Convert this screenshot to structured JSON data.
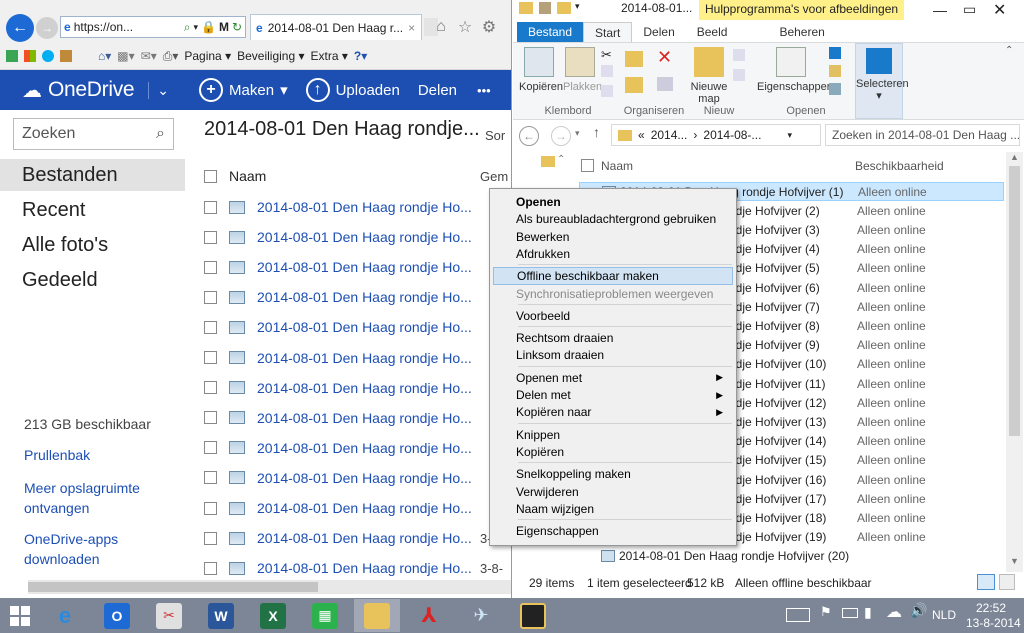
{
  "ie": {
    "url": "https://on...",
    "tab_title": "2014-08-01 Den Haag r...",
    "command_bar": {
      "page": "Pagina",
      "security": "Beveiliging",
      "extra": "Extra"
    }
  },
  "onedrive": {
    "brand": "OneDrive",
    "create": "Maken",
    "upload": "Uploaden",
    "delete": "Delen",
    "more": "•••",
    "search_placeholder": "Zoeken",
    "nav": [
      "Bestanden",
      "Recent",
      "Alle foto's",
      "Gedeeld"
    ],
    "storage": "213 GB beschikbaar",
    "recycle": "Prullenbak",
    "more_storage": "Meer opslagruimte ontvangen",
    "apps": "OneDrive-apps downloaden",
    "folder_title": "2014-08-01 Den Haag rondje...",
    "sort_label": "Sor",
    "col_name": "Naam",
    "col_date": "Gem",
    "files": [
      "2014-08-01 Den Haag rondje Ho...",
      "2014-08-01 Den Haag rondje Ho...",
      "2014-08-01 Den Haag rondje Ho...",
      "2014-08-01 Den Haag rondje Ho...",
      "2014-08-01 Den Haag rondje Ho...",
      "2014-08-01 Den Haag rondje Ho...",
      "2014-08-01 Den Haag rondje Ho...",
      "2014-08-01 Den Haag rondje Ho...",
      "2014-08-01 Den Haag rondje Ho...",
      "2014-08-01 Den Haag rondje Ho...",
      "2014-08-01 Den Haag rondje Ho...",
      "2014-08-01 Den Haag rondje Ho...",
      "2014-08-01 Den Haag rondje Ho..."
    ],
    "last_dates": [
      "3-8-",
      "3-8-"
    ]
  },
  "explorer": {
    "title": "2014-08-01...",
    "tool_context": "Hulpprogramma's voor afbeeldingen",
    "tabs": {
      "file": "Bestand",
      "start": "Start",
      "share": "Delen",
      "view": "Beeld",
      "manage": "Beheren"
    },
    "ribbon": {
      "copy": "Kopiëren",
      "paste": "Plakken",
      "clipboard": "Klembord",
      "organize": "Organiseren",
      "new_folder": "Nieuwe map",
      "new": "Nieuw",
      "properties": "Eigenschappen",
      "open": "Openen",
      "select": "Selecteren"
    },
    "breadcrumb": {
      "prefix": "«",
      "p1": "2014...",
      "p2": "2014-08-..."
    },
    "search_placeholder": "Zoeken in 2014-08-01 Den Haag ...",
    "col_name": "Naam",
    "col_avail": "Beschikbaarheid",
    "rows": [
      {
        "name": "2014-08-01 Den Haag rondje Hofvijver (1)",
        "avail": "Alleen online"
      },
      {
        "name": "ndje Hofvijver (2)",
        "avail": "Alleen online"
      },
      {
        "name": "ndje Hofvijver (3)",
        "avail": "Alleen online"
      },
      {
        "name": "ndje Hofvijver (4)",
        "avail": "Alleen online"
      },
      {
        "name": "ndje Hofvijver (5)",
        "avail": "Alleen online"
      },
      {
        "name": "ndje Hofvijver (6)",
        "avail": "Alleen online"
      },
      {
        "name": "ndje Hofvijver (7)",
        "avail": "Alleen online"
      },
      {
        "name": "ndje Hofvijver (8)",
        "avail": "Alleen online"
      },
      {
        "name": "ndje Hofvijver (9)",
        "avail": "Alleen online"
      },
      {
        "name": "ndje Hofvijver (10)",
        "avail": "Alleen online"
      },
      {
        "name": "ndje Hofvijver (11)",
        "avail": "Alleen online"
      },
      {
        "name": "ndje Hofvijver (12)",
        "avail": "Alleen online"
      },
      {
        "name": "ndje Hofvijver (13)",
        "avail": "Alleen online"
      },
      {
        "name": "ndje Hofvijver (14)",
        "avail": "Alleen online"
      },
      {
        "name": "ndje Hofvijver (15)",
        "avail": "Alleen online"
      },
      {
        "name": "ndje Hofvijver (16)",
        "avail": "Alleen online"
      },
      {
        "name": "ndje Hofvijver (17)",
        "avail": "Alleen online"
      },
      {
        "name": "ndje Hofvijver (18)",
        "avail": "Alleen online"
      },
      {
        "name": "ndje Hofvijver (19)",
        "avail": "Alleen online"
      },
      {
        "name": "2014-08-01 Den Haag rondje Hofvijver (20)",
        "avail": ""
      }
    ],
    "status": {
      "count": "29 items",
      "selected": "1 item geselecteerd",
      "size": "512 kB",
      "state": "Alleen offline beschikbaar"
    }
  },
  "context_menu": [
    {
      "label": "Openen",
      "style": "bold"
    },
    {
      "label": "Als bureaubladachtergrond gebruiken"
    },
    {
      "label": "Bewerken"
    },
    {
      "label": "Afdrukken"
    },
    {
      "label": "Offline beschikbaar maken",
      "style": "hl"
    },
    {
      "label": "Synchronisatieproblemen weergeven",
      "style": "dis"
    },
    {
      "label": "Voorbeeld"
    },
    {
      "label": "Rechtsom draaien"
    },
    {
      "label": "Linksom draaien"
    },
    {
      "label": "Openen met",
      "submenu": true
    },
    {
      "label": "Delen met",
      "submenu": true
    },
    {
      "label": "Kopiëren naar",
      "submenu": true
    },
    {
      "label": "Knippen"
    },
    {
      "label": "Kopiëren"
    },
    {
      "label": "Snelkoppeling maken"
    },
    {
      "label": "Verwijderen"
    },
    {
      "label": "Naam wijzigen"
    },
    {
      "label": "Eigenschappen"
    }
  ],
  "taskbar": {
    "lang": "NLD",
    "time": "22:52",
    "date": "13-8-2014"
  }
}
